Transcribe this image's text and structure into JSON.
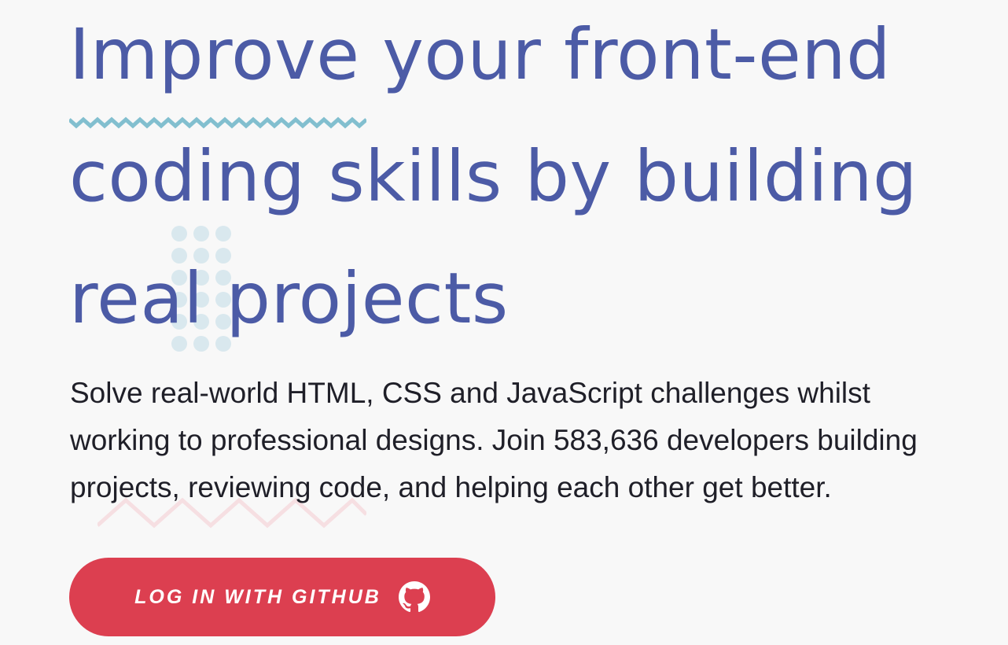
{
  "hero": {
    "headline": {
      "line1": "Improve your front-end",
      "line2": "coding skills by building",
      "line3": "real projects"
    },
    "subtext": {
      "line1": "Solve real-world HTML, CSS and JavaScript challenges whilst",
      "line2": "working to professional designs. Join 583,636 developers building",
      "line3": "projects, reviewing code, and helping each other get better."
    },
    "cta": {
      "label": "LOG IN WITH GITHUB",
      "icon": "github-icon"
    }
  },
  "colors": {
    "background": "#f8f8f8",
    "headline": "#4c5ba6",
    "body_text": "#1f1f28",
    "cta_background": "#dc3f50",
    "cta_text": "#ffffff",
    "zigzag_teal": "#82bfcf",
    "dots": "#d9e8ee",
    "zigzag_pink": "#f6dfe2"
  }
}
